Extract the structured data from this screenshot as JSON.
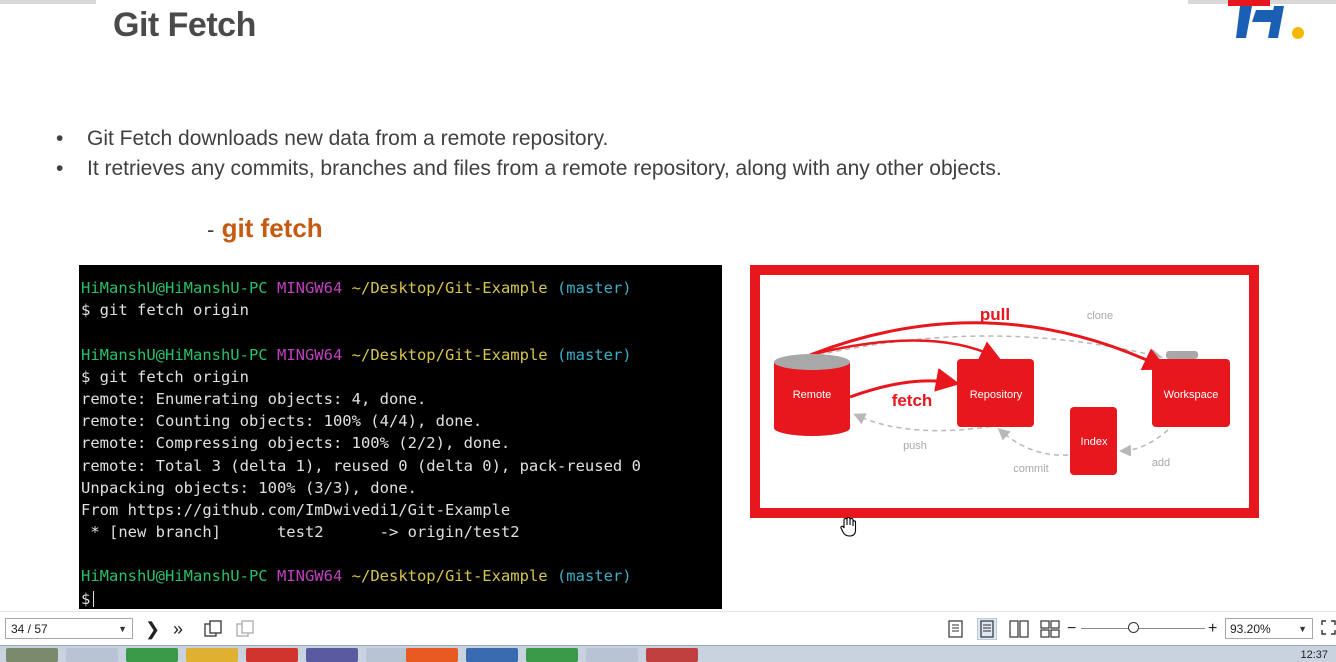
{
  "slide": {
    "title": "Git Fetch",
    "bullets": [
      "Git Fetch downloads new data from a remote repository.",
      "It retrieves any commits, branches and files from a remote repository, along with any other objects."
    ],
    "command_dash": "-",
    "command": "git fetch"
  },
  "terminal": {
    "prompt_user": "HiManshU@HiManshU-PC",
    "prompt_env": "MINGW64",
    "prompt_path": "~/Desktop/Git-Example",
    "prompt_branch": "(master)",
    "cmd1": "$ git fetch origin",
    "cmd2": "$ git fetch origin",
    "output": [
      "remote: Enumerating objects: 4, done.",
      "remote: Counting objects: 100% (4/4), done.",
      "remote: Compressing objects: 100% (2/2), done.",
      "remote: Total 3 (delta 1), reused 0 (delta 0), pack-reused 0",
      "Unpacking objects: 100% (3/3), done.",
      "From https://github.com/ImDwivedi1/Git-Example",
      " * [new branch]      test2      -> origin/test2"
    ],
    "cmd3": "$"
  },
  "diagram": {
    "nodes": {
      "remote": "Remote",
      "repository": "Repository",
      "workspace": "Workspace",
      "index": "Index"
    },
    "edges": {
      "pull": "pull",
      "clone": "clone",
      "fetch": "fetch",
      "push": "push",
      "commit": "commit",
      "add": "add"
    },
    "colors": {
      "red": "#e8161d",
      "gray": "#b8b8b8"
    }
  },
  "viewer": {
    "page_indicator": "34 / 57",
    "zoom": "93.20%",
    "zoom_level": 0.42,
    "icons": [
      "next-page-icon",
      "last-page-icon",
      "copy-icon",
      "copy-disabled-icon",
      "single-page-icon",
      "continuous-icon",
      "two-page-icon",
      "two-page-continuous-icon",
      "zoom-out-icon",
      "zoom-in-icon",
      "fullscreen-icon"
    ]
  },
  "taskbar": {
    "time": "12:37"
  }
}
